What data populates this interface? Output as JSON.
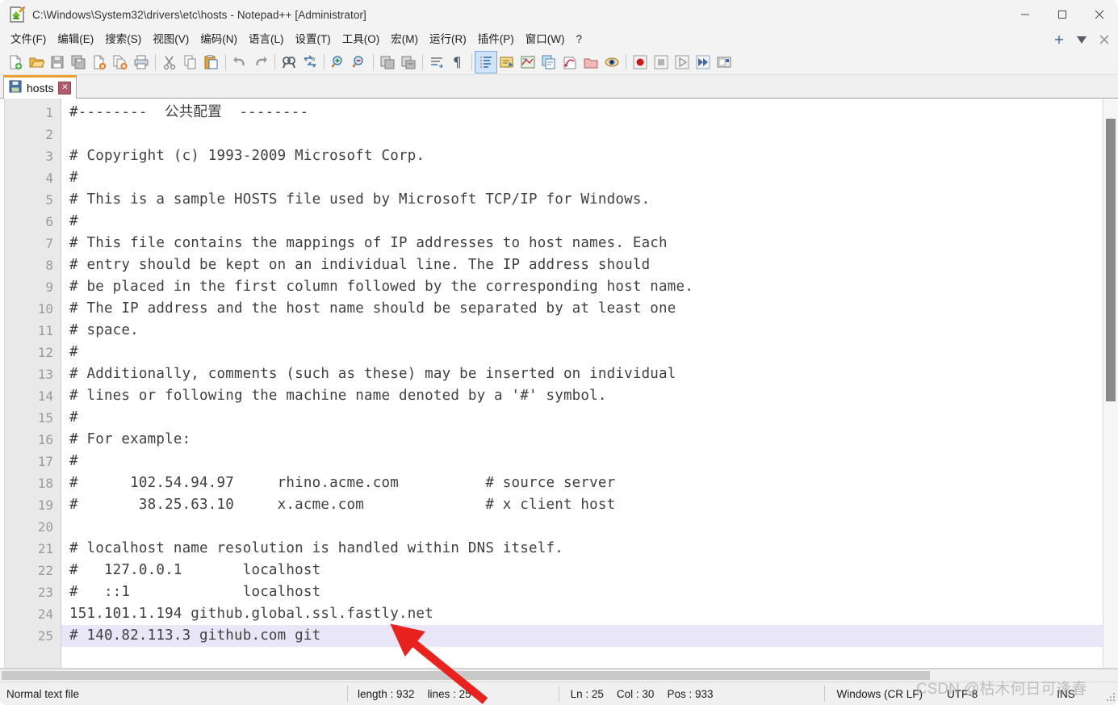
{
  "window": {
    "title": "C:\\Windows\\System32\\drivers\\etc\\hosts - Notepad++ [Administrator]",
    "icon": "notepad-plus-plus-icon",
    "minimize_label": "—",
    "maximize_label": "□",
    "close_label": "✕"
  },
  "menubar": {
    "items": [
      {
        "label": "文件(F)",
        "name": "menu-file"
      },
      {
        "label": "编辑(E)",
        "name": "menu-edit"
      },
      {
        "label": "搜索(S)",
        "name": "menu-search"
      },
      {
        "label": "视图(V)",
        "name": "menu-view"
      },
      {
        "label": "编码(N)",
        "name": "menu-encoding"
      },
      {
        "label": "语言(L)",
        "name": "menu-language"
      },
      {
        "label": "设置(T)",
        "name": "menu-settings"
      },
      {
        "label": "工具(O)",
        "name": "menu-tools"
      },
      {
        "label": "宏(M)",
        "name": "menu-macro"
      },
      {
        "label": "运行(R)",
        "name": "menu-run"
      },
      {
        "label": "插件(P)",
        "name": "menu-plugins"
      },
      {
        "label": "窗口(W)",
        "name": "menu-window"
      },
      {
        "label": "?",
        "name": "menu-help"
      }
    ],
    "right_buttons": [
      {
        "label": "+",
        "name": "new-tab-button"
      },
      {
        "label": "▼",
        "name": "tab-list-button"
      },
      {
        "label": "✕",
        "name": "close-tab-button"
      }
    ]
  },
  "toolbar": {
    "groups": [
      [
        "new-file-icon",
        "open-file-icon",
        "save-icon",
        "save-all-icon",
        "close-file-icon",
        "close-all-icon",
        "print-icon"
      ],
      [
        "cut-icon",
        "copy-icon",
        "paste-icon"
      ],
      [
        "undo-icon",
        "redo-icon"
      ],
      [
        "find-icon",
        "replace-icon"
      ],
      [
        "zoom-in-icon",
        "zoom-out-icon"
      ],
      [
        "sync-vertical-scroll-icon",
        "sync-horizontal-scroll-icon"
      ],
      [
        "word-wrap-icon",
        "show-all-characters-icon"
      ],
      [
        "indent-guide-icon",
        "user-defined-language-icon",
        "document-map-icon",
        "function-list-icon",
        "folder-as-workspace-icon",
        "document-list-icon",
        "monitoring-icon"
      ],
      [
        "record-macro-icon",
        "stop-recording-icon",
        "playback-macro-icon",
        "run-macro-multiple-icon",
        "save-macro-icon"
      ]
    ]
  },
  "tabs": [
    {
      "label": "hosts",
      "icon": "saved-document-icon",
      "close_label": "✕",
      "active": true
    }
  ],
  "editor": {
    "current_line": 25,
    "lines": [
      "#--------  公共配置  --------",
      "",
      "# Copyright (c) 1993-2009 Microsoft Corp.",
      "#",
      "# This is a sample HOSTS file used by Microsoft TCP/IP for Windows.",
      "#",
      "# This file contains the mappings of IP addresses to host names. Each",
      "# entry should be kept on an individual line. The IP address should",
      "# be placed in the first column followed by the corresponding host name.",
      "# The IP address and the host name should be separated by at least one",
      "# space.",
      "#",
      "# Additionally, comments (such as these) may be inserted on individual",
      "# lines or following the machine name denoted by a '#' symbol.",
      "#",
      "# For example:",
      "#",
      "#      102.54.94.97     rhino.acme.com          # source server",
      "#       38.25.63.10     x.acme.com              # x client host",
      "",
      "# localhost name resolution is handled within DNS itself.",
      "#   127.0.0.1       localhost",
      "#   ::1             localhost",
      "151.101.1.194 github.global.ssl.fastly.net",
      "# 140.82.113.3 github.com git"
    ]
  },
  "statusbar": {
    "file_type": "Normal text file",
    "length_label": "length : 932",
    "lines_label": "lines : 25",
    "ln_label": "Ln : 25",
    "col_label": "Col : 30",
    "pos_label": "Pos : 933",
    "eol": "Windows (CR LF)",
    "encoding": "UTF-8",
    "insert_mode": "INS"
  },
  "watermark": "CSDN @枯木何日可逢春",
  "annotation": {
    "arrow_color": "#e8231f",
    "name": "red-pointer-arrow"
  },
  "colors": {
    "tab_accent": "#f0a030",
    "current_line": "#e8e6f7",
    "gutter_bg": "#e9e9e9",
    "text": "#3f3f3f"
  }
}
